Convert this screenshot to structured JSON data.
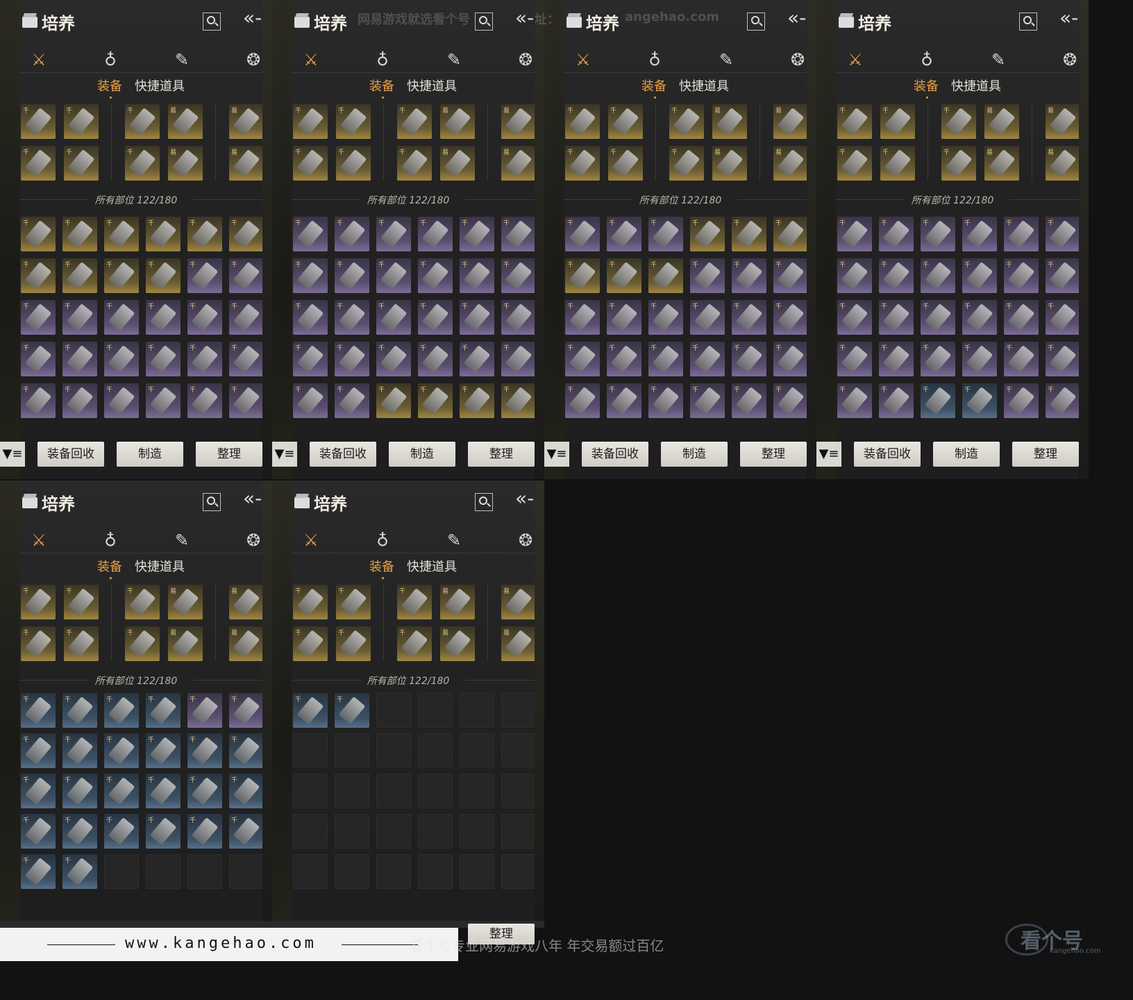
{
  "panel": {
    "title": "培养",
    "back_icon": "«-",
    "categories": [
      {
        "name": "weapon-icon",
        "glyph": "⚔"
      },
      {
        "name": "pouch-icon",
        "glyph": "♁"
      },
      {
        "name": "scroll-icon",
        "glyph": "✎"
      },
      {
        "name": "token-icon",
        "glyph": "❂"
      }
    ],
    "subtabs": [
      "装备",
      "快捷道具"
    ],
    "slots_label": "所有部位 122/180",
    "buttons": {
      "filter": "▼≡",
      "recycle": "装备回收",
      "craft": "制造",
      "sort": "整理"
    }
  },
  "watermark": {
    "top": "网易游戏就选看个号",
    "top_site": "址：",
    "top_domain": "angehao.com"
  },
  "footer": {
    "url": "www.kangehao.com",
    "slogan": "看个号专业网易游戏八年  年交易额过百亿",
    "brand": "看个号",
    "brand_sub": "kangehao.com"
  },
  "panels": [
    {
      "rows": [
        "ggggggg",
        "ppppppp"
      ]
    }
  ]
}
